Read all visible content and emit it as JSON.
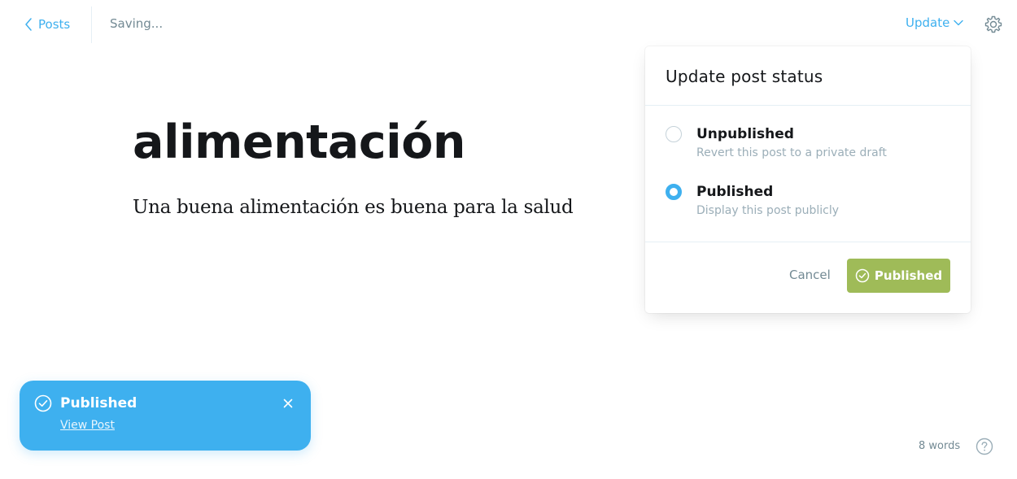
{
  "header": {
    "back_label": "Posts",
    "save_status": "Saving...",
    "update_label": "Update"
  },
  "editor": {
    "title": "alimentación",
    "body": "Una buena alimentación es buena para la salud"
  },
  "publish_menu": {
    "title": "Update post status",
    "options": [
      {
        "label": "Unpublished",
        "description": "Revert this post to a private draft",
        "checked": false
      },
      {
        "label": "Published",
        "description": "Display this post publicly",
        "checked": true
      }
    ],
    "cancel_label": "Cancel",
    "confirm_label": "Published"
  },
  "notification": {
    "title": "Published",
    "link_label": "View Post"
  },
  "footer": {
    "word_count": "8 words"
  },
  "colors": {
    "accent": "#3eb0ef",
    "success": "#9fbb58",
    "muted": "#738a94",
    "text": "#15171a"
  },
  "icons": [
    "chevron-left-icon",
    "chevron-down-icon",
    "gear-icon",
    "check-circle-icon",
    "close-icon",
    "question-circle-icon"
  ]
}
